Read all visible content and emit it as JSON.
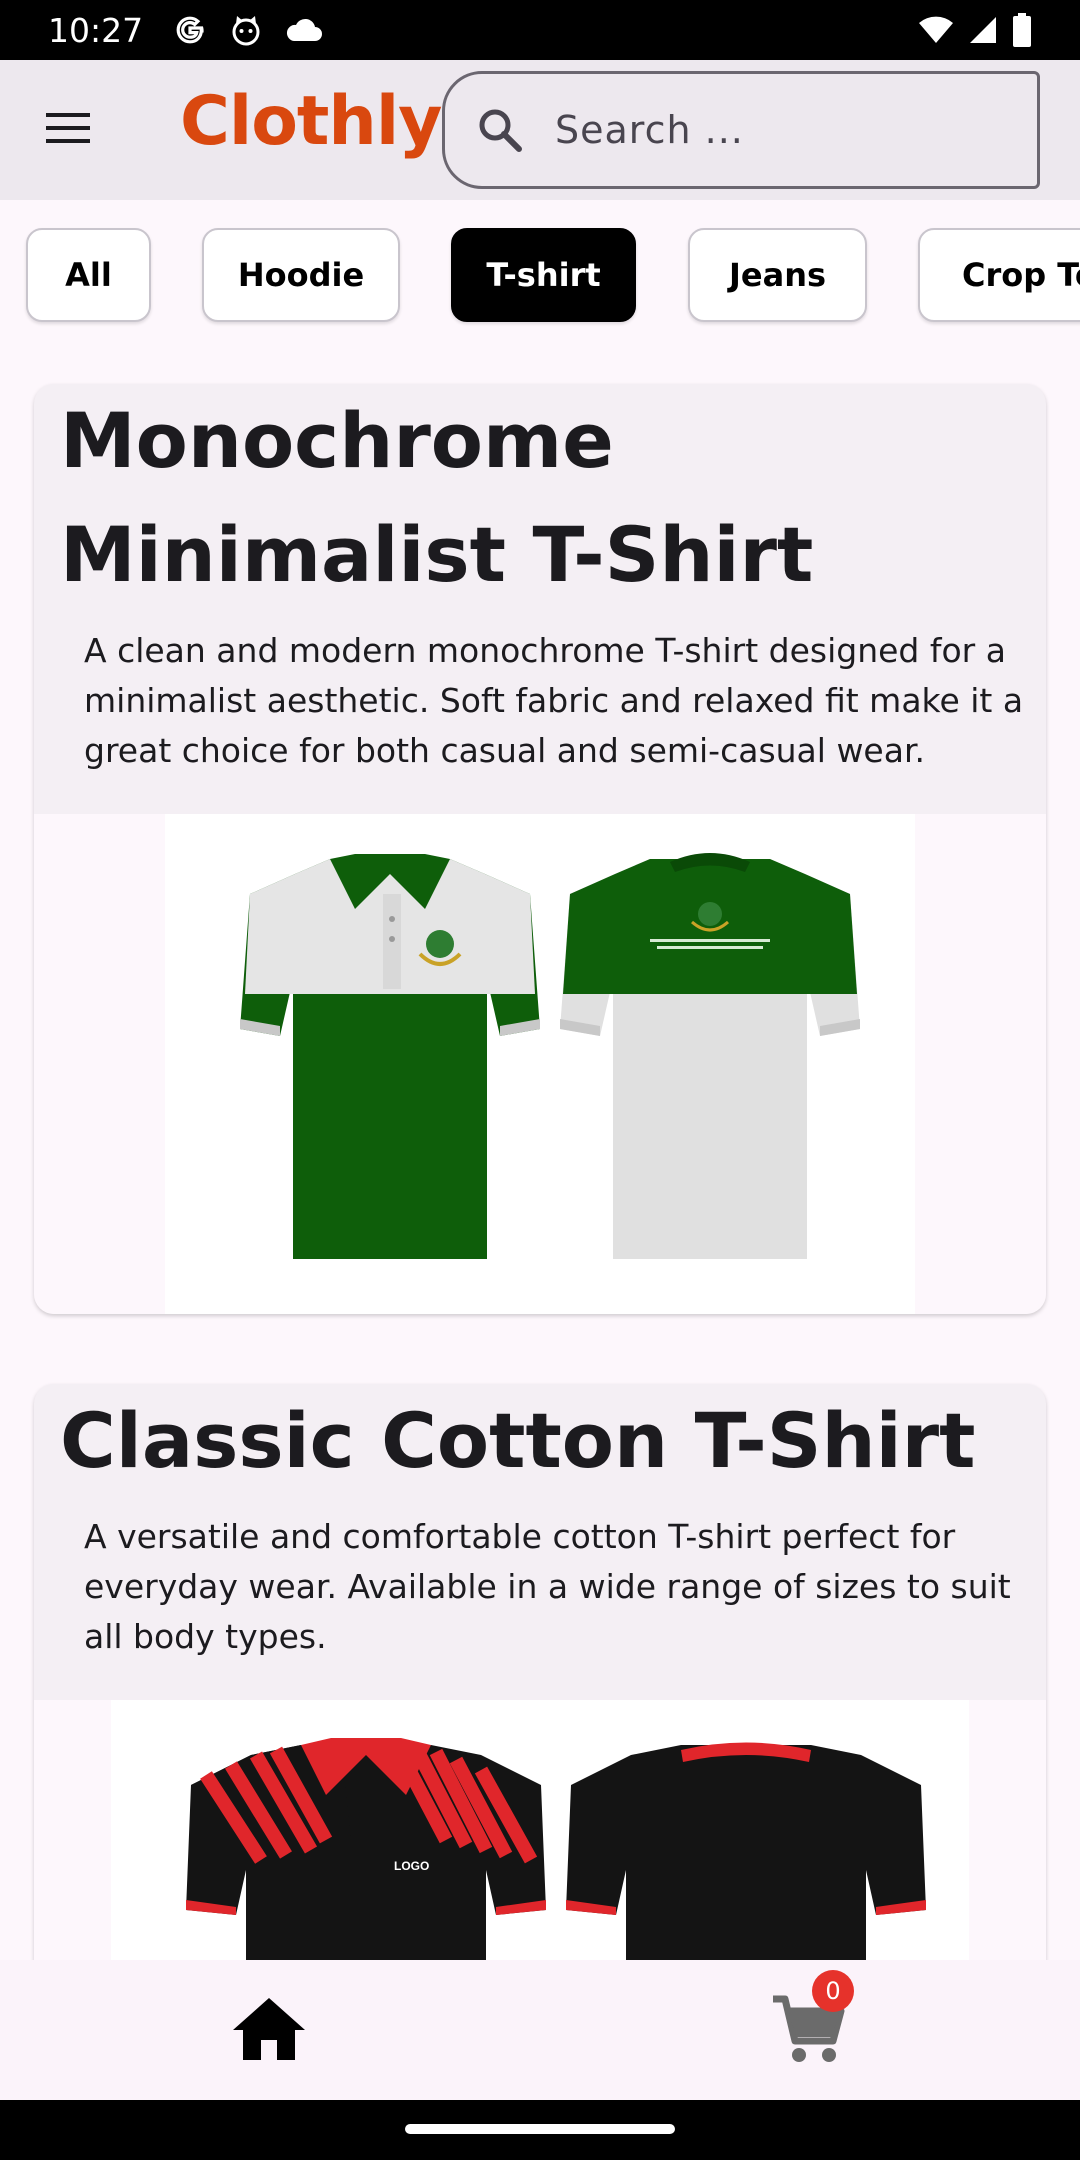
{
  "status_bar": {
    "time": "10:27",
    "left_icons": [
      "google-icon",
      "cat-icon",
      "cloud-icon"
    ],
    "right_icons": [
      "wifi-icon",
      "signal-icon",
      "battery-icon"
    ]
  },
  "app_bar": {
    "title": "Clothly",
    "title_color": "#d9480f",
    "search_placeholder": "Search ..."
  },
  "categories": [
    {
      "label": "All",
      "active": false
    },
    {
      "label": "Hoodie",
      "active": false
    },
    {
      "label": "T-shirt",
      "active": true
    },
    {
      "label": "Jeans",
      "active": false
    },
    {
      "label": "Crop To",
      "active": false
    }
  ],
  "products": [
    {
      "title": "Monochrome Minimalist T-Shirt",
      "description": "A clean and modern monochrome T-shirt designed for a minimalist aesthetic. Soft fabric and relaxed fit make it a great choice for both casual and semi-casual wear.",
      "image": "green-white-polo-shirt-front-back"
    },
    {
      "title": "Classic Cotton T-Shirt",
      "description": "A versatile and comfortable cotton T-shirt perfect for everyday wear. Available in a wide range of sizes to suit all body types.",
      "image": "black-red-polo-shirt-front-back"
    }
  ],
  "bottom_nav": {
    "home_icon": "home-icon",
    "cart_icon": "cart-icon",
    "cart_count": "0",
    "badge_color": "#e6322b"
  }
}
